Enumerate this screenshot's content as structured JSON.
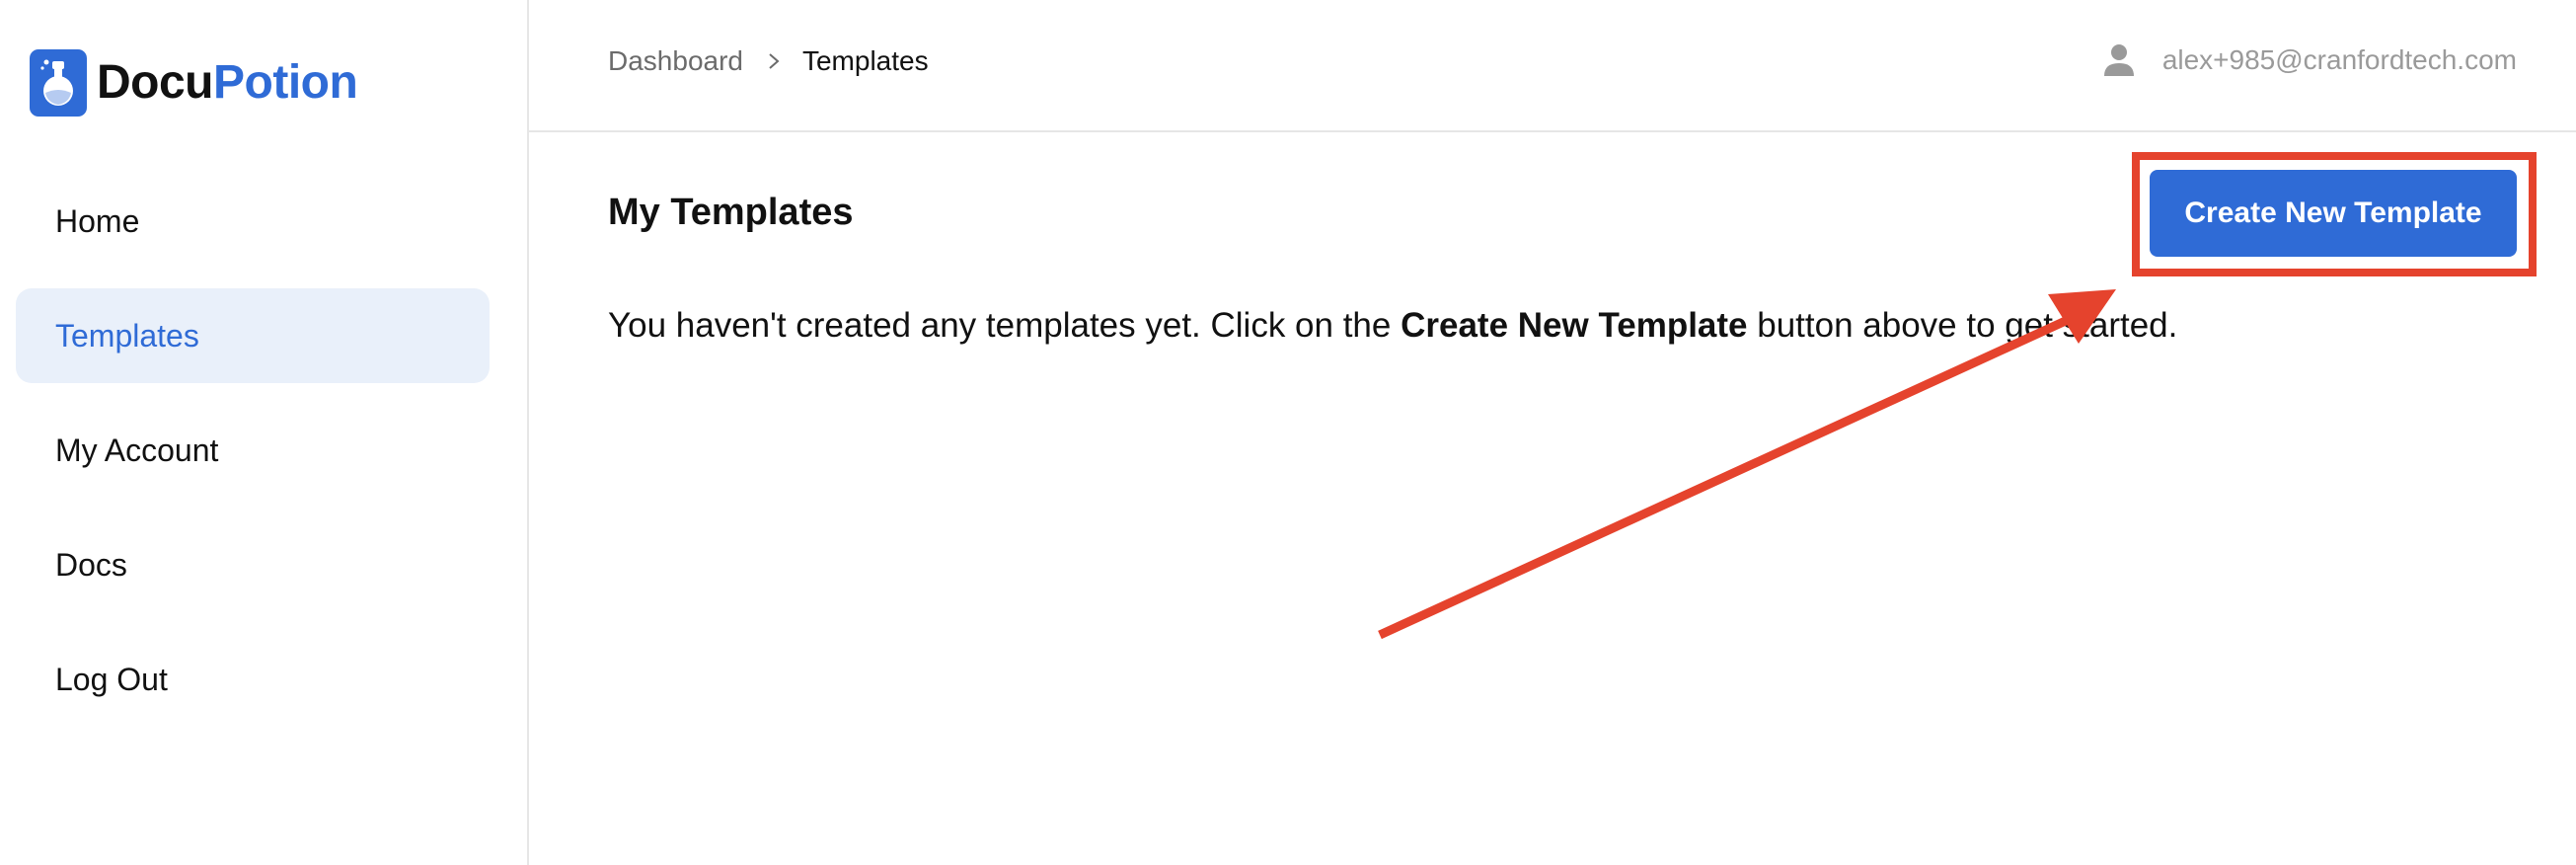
{
  "theme": {
    "accent": "#2f6bd6",
    "highlight": "#e5432d"
  },
  "brand": {
    "name_part1": "Docu",
    "name_part2": "Potion",
    "logo_icon": "potion-flask-icon"
  },
  "sidebar": {
    "items": [
      {
        "label": "Home",
        "active": false
      },
      {
        "label": "Templates",
        "active": true
      },
      {
        "label": "My Account",
        "active": false
      },
      {
        "label": "Docs",
        "active": false
      },
      {
        "label": "Log Out",
        "active": false
      }
    ]
  },
  "header": {
    "breadcrumb": {
      "parent": "Dashboard",
      "separator_icon": "chevron-right-icon",
      "current": "Templates"
    },
    "user": {
      "icon": "user-icon",
      "email": "alex+985@cranfordtech.com"
    }
  },
  "main": {
    "title": "My Templates",
    "create_button_label": "Create New Template",
    "empty_message": {
      "before": "You haven't created any templates yet. Click on the ",
      "bold": "Create New Template",
      "after": " button above to get started."
    }
  },
  "annotation": {
    "highlight_target": "create-new-template-button",
    "arrow_icon": "arrow-annotation"
  }
}
